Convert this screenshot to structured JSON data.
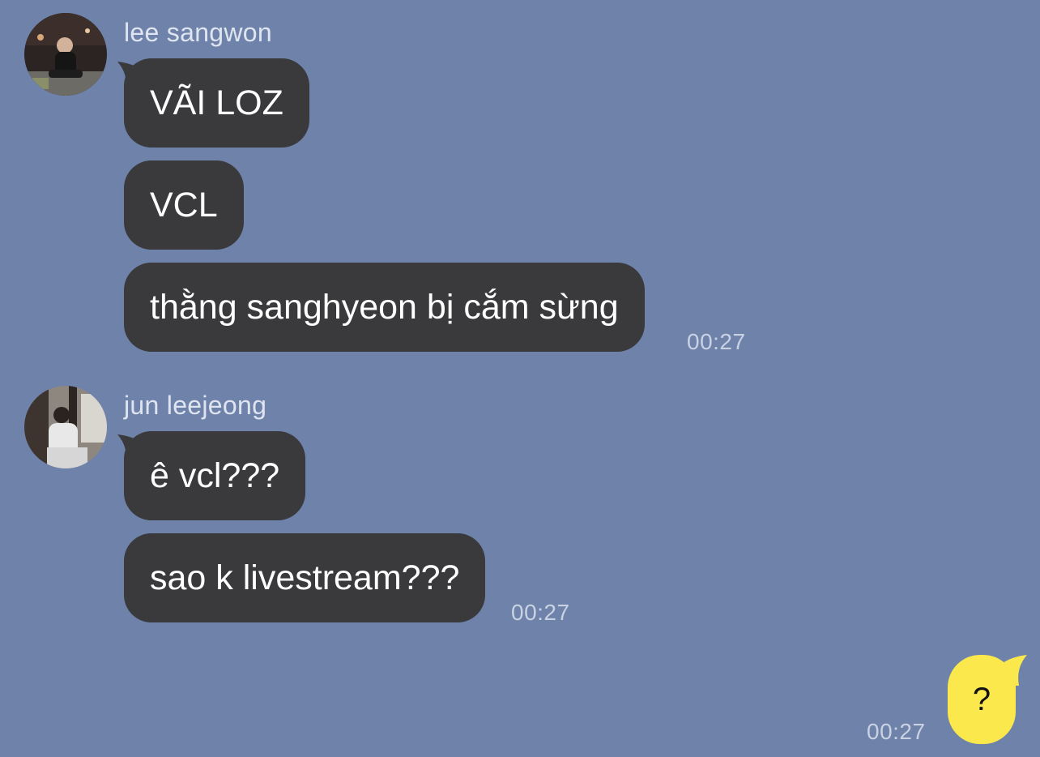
{
  "colors": {
    "background": "#6f82aa",
    "incoming_bubble": "#3a3a3c",
    "outgoing_bubble": "#fae84c"
  },
  "groups": [
    {
      "sender": "lee sangwon",
      "messages": [
        "VÃI LOZ",
        "VCL",
        "thằng sanghyeon bị cắm sừng"
      ],
      "time": "00:27"
    },
    {
      "sender": "jun leejeong",
      "messages": [
        "ê vcl???",
        "sao k livestream???"
      ],
      "time": "00:27"
    }
  ],
  "outgoing": {
    "text": "?",
    "time": "00:27"
  }
}
